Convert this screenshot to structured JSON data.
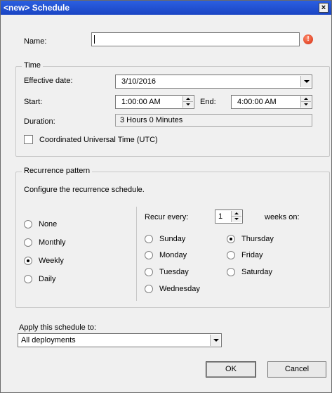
{
  "window": {
    "title": "<new> Schedule",
    "close_glyph": "×"
  },
  "name_field": {
    "label": "Name:",
    "value": "",
    "warning_icon": "error-icon"
  },
  "time": {
    "group_title": "Time",
    "effective_date_label": "Effective date:",
    "effective_date_value": "3/10/2016",
    "start_label": "Start:",
    "start_value": "1:00:00 AM",
    "end_label": "End:",
    "end_value": "4:00:00 AM",
    "duration_label": "Duration:",
    "duration_value": "3 Hours 0 Minutes",
    "utc_label": "Coordinated Universal Time (UTC)",
    "utc_checked": false
  },
  "recurrence": {
    "group_title": "Recurrence pattern",
    "description": "Configure the recurrence schedule.",
    "patterns": [
      {
        "label": "None",
        "checked": false
      },
      {
        "label": "Monthly",
        "checked": false
      },
      {
        "label": "Weekly",
        "checked": true
      },
      {
        "label": "Daily",
        "checked": false
      }
    ],
    "recur_every_label": "Recur every:",
    "recur_every_value": "1",
    "weeks_on_label": "weeks on:",
    "days_left": [
      {
        "label": "Sunday",
        "checked": false
      },
      {
        "label": "Monday",
        "checked": false
      },
      {
        "label": "Tuesday",
        "checked": false
      },
      {
        "label": "Wednesday",
        "checked": false
      }
    ],
    "days_right": [
      {
        "label": "Thursday",
        "checked": true
      },
      {
        "label": "Friday",
        "checked": false
      },
      {
        "label": "Saturday",
        "checked": false
      }
    ]
  },
  "apply": {
    "label": "Apply this schedule to:",
    "value": "All deployments"
  },
  "buttons": {
    "ok": "OK",
    "cancel": "Cancel"
  }
}
